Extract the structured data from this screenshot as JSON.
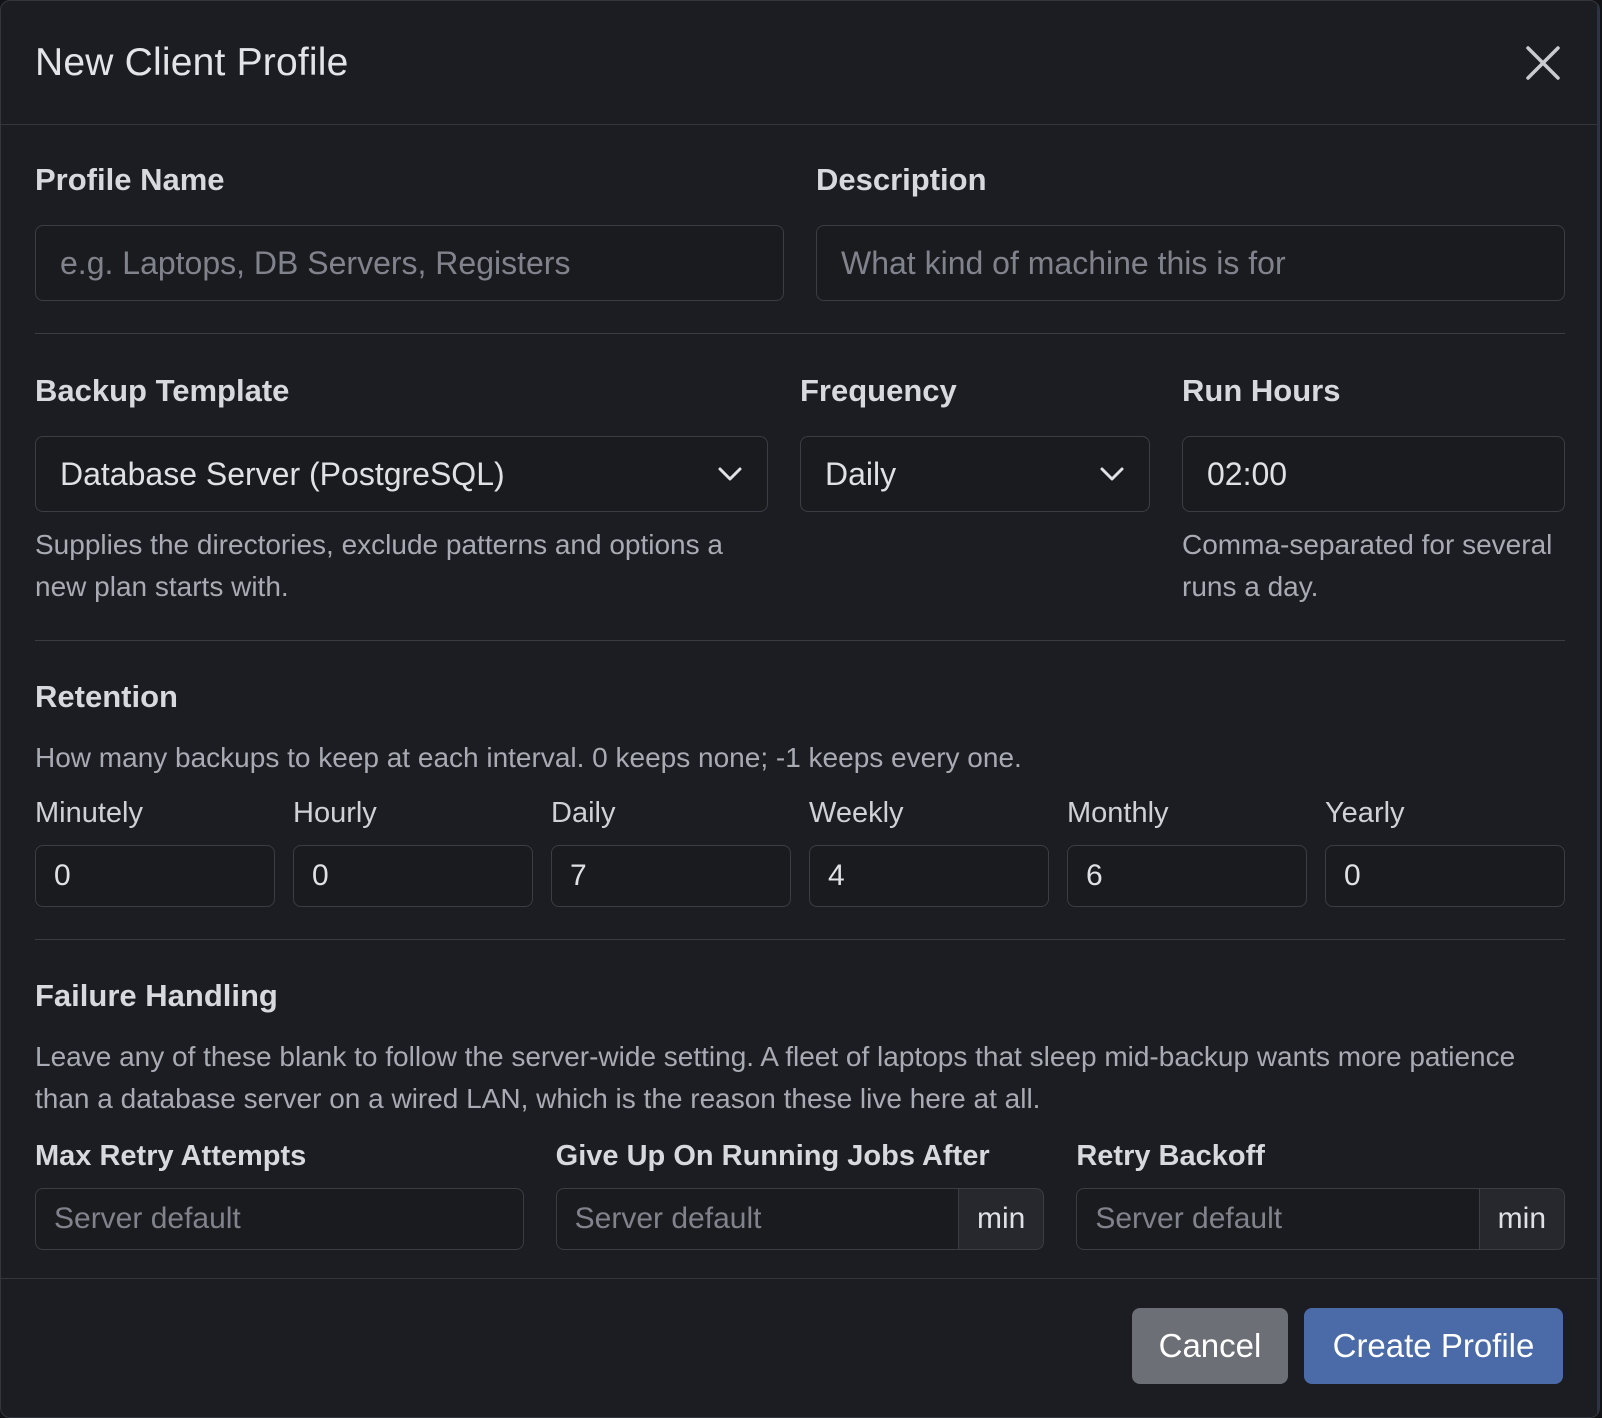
{
  "dialog": {
    "title": "New Client Profile",
    "close_icon": "close-icon"
  },
  "profile": {
    "name_label": "Profile Name",
    "name_placeholder": "e.g. Laptops, DB Servers, Registers",
    "name_value": "",
    "description_label": "Description",
    "description_placeholder": "What kind of machine this is for",
    "description_value": ""
  },
  "schedule": {
    "template_label": "Backup Template",
    "template_value": "Database Server (PostgreSQL)",
    "template_help": "Supplies the directories, exclude patterns and options a new plan starts with.",
    "frequency_label": "Frequency",
    "frequency_value": "Daily",
    "run_hours_label": "Run Hours",
    "run_hours_value": "02:00",
    "run_hours_help": "Comma-separated for several runs a day.",
    "chevron_icon": "chevron-down-icon"
  },
  "retention": {
    "title": "Retention",
    "description": "How many backups to keep at each interval. 0 keeps none; -1 keeps every one.",
    "fields": [
      {
        "label": "Minutely",
        "value": "0"
      },
      {
        "label": "Hourly",
        "value": "0"
      },
      {
        "label": "Daily",
        "value": "7"
      },
      {
        "label": "Weekly",
        "value": "4"
      },
      {
        "label": "Monthly",
        "value": "6"
      },
      {
        "label": "Yearly",
        "value": "0"
      }
    ]
  },
  "failure": {
    "title": "Failure Handling",
    "description": "Leave any of these blank to follow the server-wide setting. A fleet of laptops that sleep mid-backup wants more patience than a database server on a wired LAN, which is the reason these live here at all.",
    "max_retry_label": "Max Retry Attempts",
    "max_retry_placeholder": "Server default",
    "give_up_label": "Give Up On Running Jobs After",
    "give_up_placeholder": "Server default",
    "give_up_unit": "min",
    "backoff_label": "Retry Backoff",
    "backoff_placeholder": "Server default",
    "backoff_unit": "min"
  },
  "footer": {
    "cancel_label": "Cancel",
    "submit_label": "Create Profile"
  },
  "colors": {
    "background": "#1c1d22",
    "primary_button": "#4a6aa8",
    "secondary_button": "#6c7076",
    "border": "#3b3d45"
  }
}
